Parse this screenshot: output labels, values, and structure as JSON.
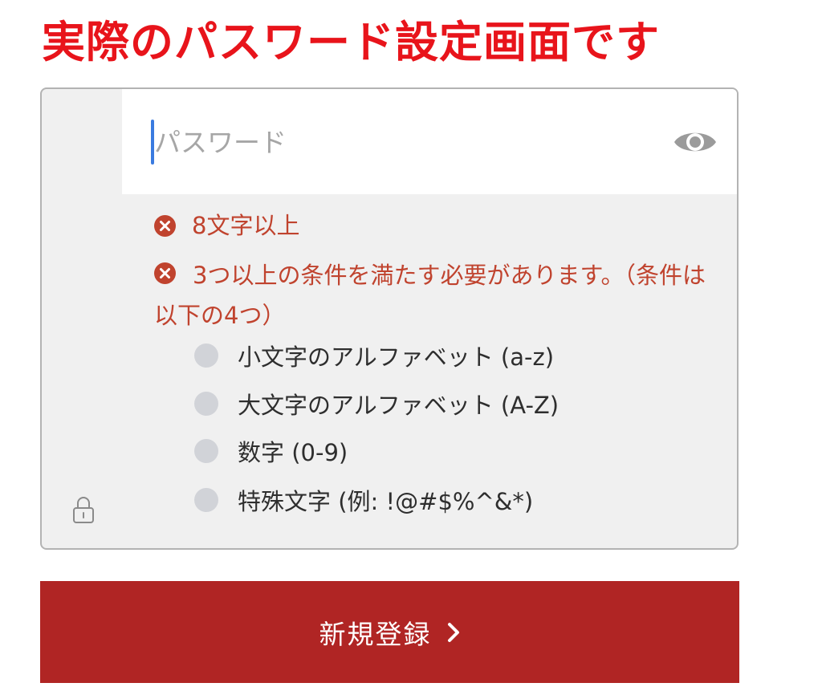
{
  "headline": "実際のパスワード設定画面です",
  "password": {
    "value": "",
    "placeholder": "パスワード",
    "toggle_icon": "eye-icon",
    "field_icon": "lock-icon"
  },
  "requirements": [
    {
      "text": "8文字以上",
      "status": "unmet",
      "icon": "x-circle-icon"
    },
    {
      "text": "3つ以上の条件を満たす必要があります。（条件は以下の4つ）",
      "status": "unmet",
      "icon": "x-circle-icon"
    }
  ],
  "conditions": [
    {
      "label": "小文字のアルファベット (a-z)",
      "met": false
    },
    {
      "label": "大文字のアルファベット (A-Z)",
      "met": false
    },
    {
      "label": "数字 (0-9)",
      "met": false
    },
    {
      "label": "特殊文字 (例: !@#$%^&*)",
      "met": false
    }
  ],
  "submit": {
    "label": "新規登録",
    "icon": "chevron-right-icon"
  },
  "colors": {
    "headline": "#e8141b",
    "error": "#c0432e",
    "button": "#b02524",
    "panel_bg": "#f0f0f0",
    "caret": "#3a7be0"
  }
}
